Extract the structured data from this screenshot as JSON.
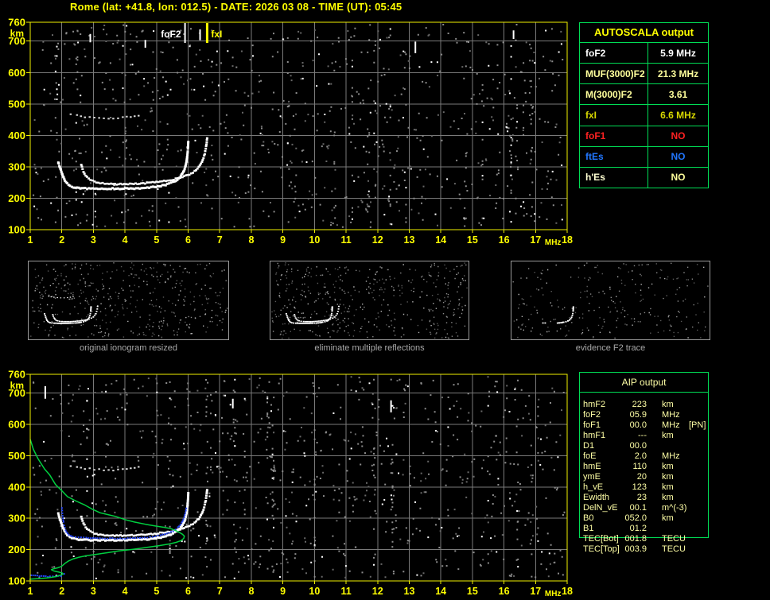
{
  "title": "Rome (lat: +41.8, lon: 012.5) - DATE: 2026 03 08 - TIME (UT): 05:45",
  "colors": {
    "background": "#000000",
    "axis_yellow": "#f0f000",
    "label_yellow": "#ffff00",
    "grid_gray": "#7a7a7a",
    "trace_white": "#ffffff",
    "hop_gray": "#d8d8d8",
    "noise_gray": "#8c8c8c",
    "noise_dark": "#686868",
    "profile_green": "#00d040",
    "restored_blue": "#2747ff",
    "table_border": "#00dd55",
    "caption_gray": "#a8a8a8",
    "thumb_border": "#999999",
    "aip_text": "#ffffa6"
  },
  "autoscala_table": {
    "header": "AUTOSCALA output",
    "rows": [
      {
        "label": "foF2",
        "value": "5.9 MHz",
        "color": "#ffffff"
      },
      {
        "label": "MUF(3000)F2",
        "value": "21.3 MHz",
        "color": "#ffff9c"
      },
      {
        "label": "M(3000)F2",
        "value": "3.61",
        "color": "#ffff9c"
      },
      {
        "label": "fxI",
        "value": "6.6 MHz",
        "color": "#d8d800"
      },
      {
        "label": "foF1",
        "value": "NO",
        "color": "#ff2222"
      },
      {
        "label": "ftEs",
        "value": "NO",
        "color": "#2277ff"
      },
      {
        "label": "h'Es",
        "value": "NO",
        "color": "#ffffd2",
        "value_color": "#ffff9c"
      }
    ]
  },
  "aip_table": {
    "header": "AIP output",
    "rows": [
      {
        "label": "hmF2",
        "value": "223",
        "unit": "km",
        "extra": ""
      },
      {
        "label": "foF2",
        "value": "05.9",
        "unit": "MHz",
        "extra": ""
      },
      {
        "label": "foF1",
        "value": "00.0",
        "unit": "MHz",
        "extra": "[PN]"
      },
      {
        "label": "hmF1",
        "value": "---",
        "unit": "km",
        "extra": ""
      },
      {
        "label": "D1",
        "value": "00.0",
        "unit": "",
        "extra": ""
      },
      {
        "label": "foE",
        "value": "2.0",
        "unit": "MHz",
        "extra": ""
      },
      {
        "label": "hmE",
        "value": "110",
        "unit": "km",
        "extra": ""
      },
      {
        "label": "ymE",
        "value": "20",
        "unit": "km",
        "extra": ""
      },
      {
        "label": "h_vE",
        "value": "123",
        "unit": "km",
        "extra": ""
      },
      {
        "label": "Ewidth",
        "value": "23",
        "unit": "km",
        "extra": ""
      },
      {
        "label": "DelN_vE",
        "value": "00.1",
        "unit": "m^(-3)",
        "extra": ""
      },
      {
        "label": "B0",
        "value": "052.0",
        "unit": "km",
        "extra": ""
      },
      {
        "label": "B1",
        "value": "01.2",
        "unit": "",
        "extra": ""
      },
      {
        "label": "TEC[Bot]",
        "value": "001.8",
        "unit": "TECU",
        "extra": ""
      },
      {
        "label": "TEC[Top]",
        "value": "003.9",
        "unit": "TECU",
        "extra": ""
      }
    ]
  },
  "thumbnails": [
    {
      "caption": "original ionogram resized"
    },
    {
      "caption": "eliminate multiple reflections"
    },
    {
      "caption": "evidence F2 trace"
    }
  ],
  "chart_data": [
    {
      "id": "top_ionogram",
      "type": "scatter",
      "title": "scaled ionogram with foF2 and fxI markers",
      "xlabel": "MHz",
      "ylabel": "km",
      "xlim": [
        1,
        18
      ],
      "ylim": [
        100,
        760
      ],
      "x_ticks": [
        1,
        2,
        3,
        4,
        5,
        6,
        7,
        8,
        9,
        10,
        11,
        12,
        13,
        14,
        15,
        16,
        17,
        18
      ],
      "y_ticks": [
        760,
        700,
        600,
        500,
        400,
        300,
        200,
        100
      ],
      "grid": true,
      "markers": [
        {
          "label": "foF2",
          "freq_mhz": 5.9,
          "color": "#ffffff"
        },
        {
          "label": "fxI",
          "freq_mhz": 6.6,
          "color": "#ffff00"
        }
      ],
      "series": [
        {
          "key": "o_trace",
          "name": "F2 layer O-mode echo trace",
          "points": [
            [
              1.85,
              318
            ],
            [
              1.9,
              302
            ],
            [
              1.95,
              288
            ],
            [
              2.0,
              274
            ],
            [
              2.06,
              261
            ],
            [
              2.13,
              251
            ],
            [
              2.22,
              244
            ],
            [
              2.34,
              239
            ],
            [
              2.5,
              236
            ],
            [
              2.7,
              235
            ],
            [
              3.0,
              234
            ],
            [
              3.4,
              234
            ],
            [
              3.8,
              234
            ],
            [
              4.2,
              235
            ],
            [
              4.55,
              236
            ],
            [
              4.85,
              239
            ],
            [
              5.1,
              243
            ],
            [
              5.3,
              248
            ],
            [
              5.48,
              255
            ],
            [
              5.62,
              263
            ],
            [
              5.73,
              274
            ],
            [
              5.81,
              287
            ],
            [
              5.87,
              302
            ],
            [
              5.91,
              320
            ],
            [
              5.94,
              342
            ],
            [
              5.96,
              366
            ],
            [
              5.97,
              390
            ]
          ]
        },
        {
          "key": "x_trace",
          "name": "F2 layer X-mode echo trace",
          "points": [
            [
              2.58,
              310
            ],
            [
              2.62,
              295
            ],
            [
              2.68,
              281
            ],
            [
              2.76,
              270
            ],
            [
              2.87,
              261
            ],
            [
              3.0,
              255
            ],
            [
              3.18,
              251
            ],
            [
              3.4,
              249
            ],
            [
              3.7,
              248
            ],
            [
              4.0,
              248
            ],
            [
              4.3,
              249
            ],
            [
              4.6,
              251
            ],
            [
              4.9,
              254
            ],
            [
              5.2,
              258
            ],
            [
              5.5,
              263
            ],
            [
              5.78,
              270
            ],
            [
              6.0,
              279
            ],
            [
              6.17,
              289
            ],
            [
              6.3,
              302
            ],
            [
              6.4,
              318
            ],
            [
              6.47,
              338
            ],
            [
              6.52,
              360
            ],
            [
              6.55,
              382
            ],
            [
              6.57,
              400
            ]
          ]
        },
        {
          "key": "second_hop",
          "name": "second-hop echo",
          "points": [
            [
              2.25,
              471
            ],
            [
              2.45,
              466
            ],
            [
              2.7,
              462
            ],
            [
              3.0,
              459
            ],
            [
              3.3,
              457
            ],
            [
              3.6,
              457
            ],
            [
              3.9,
              459
            ],
            [
              4.15,
              462
            ],
            [
              4.4,
              467
            ],
            [
              4.6,
              472
            ]
          ]
        }
      ]
    },
    {
      "id": "bottom_ionogram",
      "type": "scatter",
      "title": "ionogram with restored trace and electron density profile",
      "xlabel": "MHz",
      "ylabel": "km",
      "xlim": [
        1,
        18
      ],
      "ylim": [
        100,
        760
      ],
      "x_ticks": [
        1,
        2,
        3,
        4,
        5,
        6,
        7,
        8,
        9,
        10,
        11,
        12,
        13,
        14,
        15,
        16,
        17,
        18
      ],
      "y_ticks": [
        760,
        700,
        600,
        500,
        400,
        300,
        200,
        100
      ],
      "grid": true,
      "series": [
        {
          "key": "same_as_top",
          "name": "F2 O/X traces and second hop (same as top ionogram)",
          "ref_chart": 0
        },
        {
          "key": "restored",
          "name": "restored trace (blue)",
          "segments": [
            [
              [
                1.98,
                335
              ],
              [
                2.0,
                310
              ],
              [
                2.03,
                290
              ],
              [
                2.07,
                272
              ],
              [
                2.12,
                258
              ],
              [
                2.2,
                249
              ],
              [
                2.32,
                244
              ],
              [
                2.5,
                241
              ],
              [
                2.75,
                240
              ],
              [
                3.1,
                239
              ],
              [
                3.5,
                238
              ],
              [
                3.9,
                238
              ],
              [
                4.3,
                239
              ],
              [
                4.6,
                241
              ],
              [
                4.85,
                244
              ],
              [
                5.1,
                248
              ],
              [
                5.3,
                254
              ],
              [
                5.5,
                262
              ],
              [
                5.65,
                273
              ],
              [
                5.77,
                288
              ],
              [
                5.85,
                306
              ],
              [
                5.9,
                326
              ],
              [
                5.93,
                340
              ]
            ],
            [
              [
                1.0,
                121
              ],
              [
                1.2,
                119
              ],
              [
                1.4,
                117
              ],
              [
                1.6,
                116
              ],
              [
                1.78,
                116
              ],
              [
                1.95,
                119
              ],
              [
                2.05,
                124
              ],
              [
                2.1,
                129
              ]
            ]
          ]
        },
        {
          "key": "profile",
          "name": "electron density profile (green)",
          "points": [
            [
              1.0,
              552
            ],
            [
              1.1,
              520
            ],
            [
              1.25,
              490
            ],
            [
              1.45,
              458
            ],
            [
              1.62,
              438
            ],
            [
              1.8,
              408
            ],
            [
              2.0,
              388
            ],
            [
              2.18,
              369
            ],
            [
              2.45,
              355
            ],
            [
              2.7,
              344
            ],
            [
              2.95,
              330
            ],
            [
              3.2,
              318
            ],
            [
              3.45,
              312
            ],
            [
              3.7,
              306
            ],
            [
              4.0,
              296
            ],
            [
              4.3,
              288
            ],
            [
              4.65,
              281
            ],
            [
              5.0,
              275
            ],
            [
              5.25,
              271
            ],
            [
              5.45,
              267
            ],
            [
              5.6,
              261
            ],
            [
              5.72,
              255
            ],
            [
              5.82,
              249
            ],
            [
              5.88,
              243
            ],
            [
              5.86,
              236
            ],
            [
              5.78,
              229
            ],
            [
              5.62,
              223
            ],
            [
              5.4,
              218
            ],
            [
              5.1,
              213
            ],
            [
              4.7,
              207
            ],
            [
              4.25,
              201
            ],
            [
              3.8,
              196
            ],
            [
              3.44,
              190
            ],
            [
              3.1,
              185
            ],
            [
              2.8,
              181
            ],
            [
              2.55,
              176
            ],
            [
              2.35,
              170
            ],
            [
              2.2,
              163
            ],
            [
              2.1,
              156
            ],
            [
              2.03,
              150
            ],
            [
              1.98,
              146
            ],
            [
              1.87,
              142
            ],
            [
              1.75,
              139
            ],
            [
              1.67,
              136
            ],
            [
              1.74,
              132
            ],
            [
              1.88,
              129
            ],
            [
              2.0,
              126
            ],
            [
              2.04,
              122
            ],
            [
              1.95,
              118
            ],
            [
              1.82,
              114
            ],
            [
              1.7,
              112
            ],
            [
              1.55,
              110
            ],
            [
              1.38,
              108
            ],
            [
              1.2,
              107
            ],
            [
              1.05,
              106
            ],
            [
              0.97,
              105
            ]
          ]
        }
      ]
    }
  ]
}
